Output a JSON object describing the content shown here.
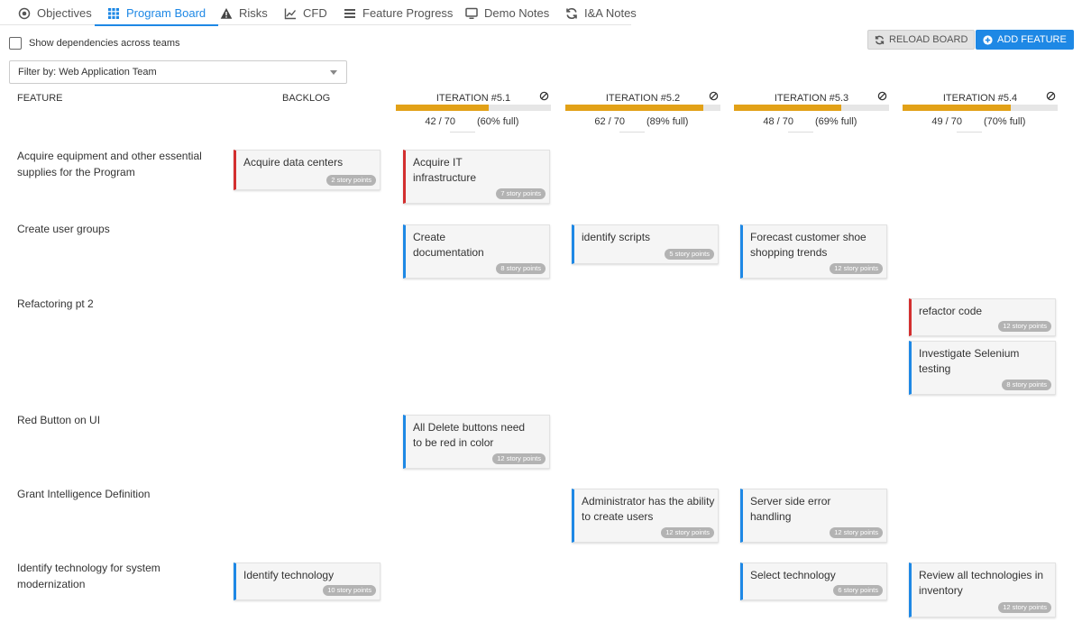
{
  "tabs": [
    {
      "label": "Objectives",
      "icon": "target-icon"
    },
    {
      "label": "Program Board",
      "icon": "grid-icon",
      "active": true
    },
    {
      "label": "Risks",
      "icon": "warning-icon"
    },
    {
      "label": "CFD",
      "icon": "line-chart-icon"
    },
    {
      "label": "Feature Progress",
      "icon": "list-bars-icon"
    },
    {
      "label": "Demo Notes",
      "icon": "monitor-icon"
    },
    {
      "label": "I&A Notes",
      "icon": "refresh-icon"
    }
  ],
  "controls": {
    "dependencies_label": "Show dependencies across teams",
    "reload_label": "RELOAD BOARD",
    "add_label": "ADD FEATURE",
    "filter_value": "Filter by: Web Application Team"
  },
  "columns": {
    "feature": "FEATURE",
    "backlog": "BACKLOG"
  },
  "iterations": [
    {
      "title": "ITERATION #5.1",
      "points": "42 / 70",
      "percent": "(60% full)",
      "fill": 0.6
    },
    {
      "title": "ITERATION #5.2",
      "points": "62 / 70",
      "percent": "(89% full)",
      "fill": 0.89
    },
    {
      "title": "ITERATION #5.3",
      "points": "48 / 70",
      "percent": "(69% full)",
      "fill": 0.69
    },
    {
      "title": "ITERATION #5.4",
      "points": "49 / 70",
      "percent": "(70% full)",
      "fill": 0.7
    }
  ],
  "features": [
    "Acquire equipment and other essential supplies for the Program",
    "Create user groups",
    "Refactoring pt 2",
    "Red Button on UI",
    "Grant Intelligence Definition",
    "Identify technology for system modernization"
  ],
  "cards": [
    {
      "title": "Acquire data centers",
      "points": "2 story points",
      "color": "#d32f2f"
    },
    {
      "title": "Acquire IT infrastructure",
      "points": "7 story points",
      "color": "#d32f2f"
    },
    {
      "title": "Create documentation",
      "points": "8 story points",
      "color": "#1e88e5"
    },
    {
      "title": "identify scripts",
      "points": "5 story points",
      "color": "#1e88e5"
    },
    {
      "title": "Forecast customer shoe shopping trends",
      "points": "12 story points",
      "color": "#1e88e5"
    },
    {
      "title": "refactor code",
      "points": "12 story points",
      "color": "#d32f2f"
    },
    {
      "title": "Investigate Selenium testing",
      "points": "8 story points",
      "color": "#1e88e5"
    },
    {
      "title": "All Delete buttons need to be red in color",
      "points": "12 story points",
      "color": "#1e88e5"
    },
    {
      "title": "Administrator has the ability to create users",
      "points": "12 story points",
      "color": "#1e88e5"
    },
    {
      "title": "Server side error handling",
      "points": "12 story points",
      "color": "#1e88e5"
    },
    {
      "title": "Identify technology",
      "points": "10 story points",
      "color": "#1e88e5"
    },
    {
      "title": "Select technology",
      "points": "6 story points",
      "color": "#1e88e5"
    },
    {
      "title": "Review all technologies in inventory",
      "points": "12 story points",
      "color": "#1e88e5"
    }
  ]
}
